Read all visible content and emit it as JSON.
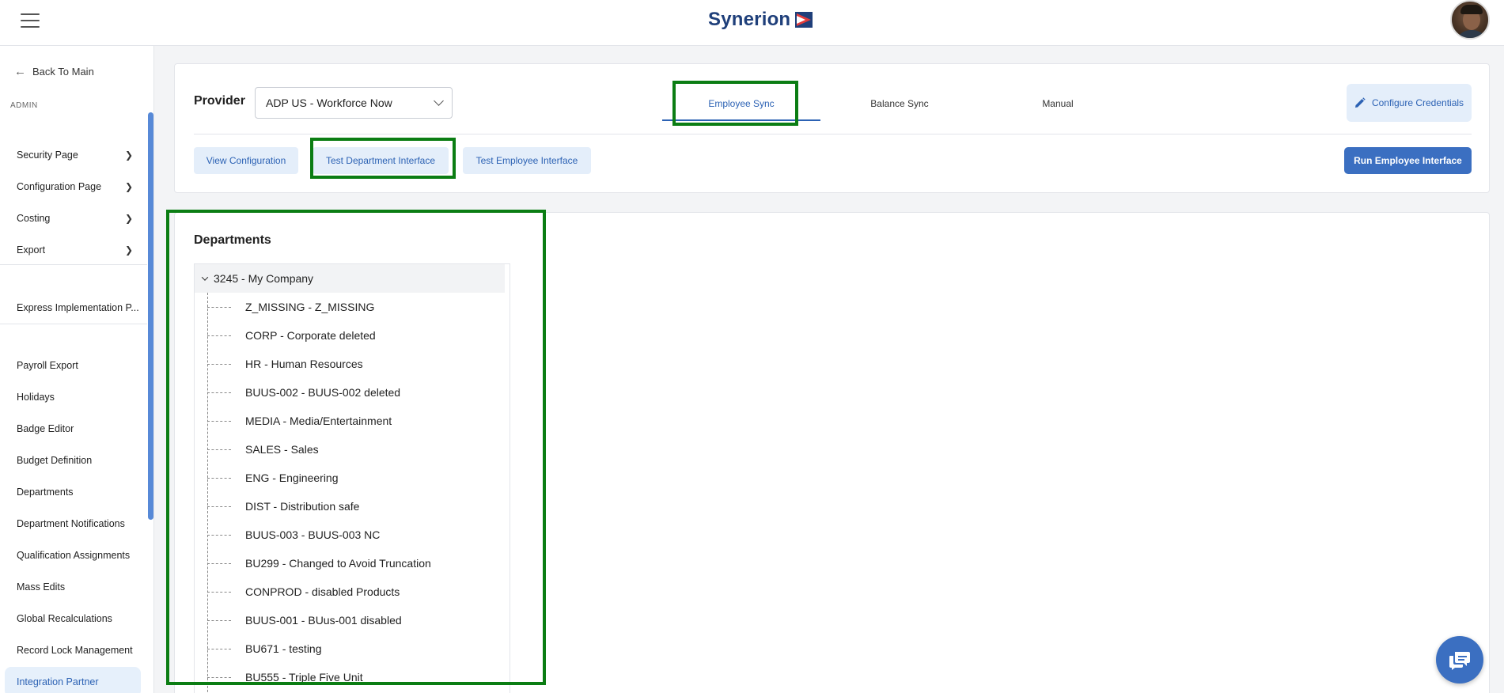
{
  "header": {
    "logo_text": "Synerion",
    "brand_color": "#1f3f7a",
    "accent_color": "#e23b3b"
  },
  "sidebar": {
    "back_label": "Back To Main",
    "section_label": "ADMIN",
    "group_items": [
      {
        "label": "Security Page"
      },
      {
        "label": "Configuration Page"
      },
      {
        "label": "Costing"
      },
      {
        "label": "Export"
      }
    ],
    "express_item": "Express Implementation P...",
    "items": [
      {
        "label": "Payroll Export"
      },
      {
        "label": "Holidays"
      },
      {
        "label": "Badge Editor"
      },
      {
        "label": "Budget Definition"
      },
      {
        "label": "Departments"
      },
      {
        "label": "Department Notifications"
      },
      {
        "label": "Qualification Assignments"
      },
      {
        "label": "Mass Edits"
      },
      {
        "label": "Global Recalculations"
      },
      {
        "label": "Record Lock Management"
      },
      {
        "label": "Integration Partner"
      }
    ],
    "active_item": "Integration Partner"
  },
  "toolbar": {
    "provider_label": "Provider",
    "provider_value": "ADP US - Workforce Now",
    "tabs": [
      {
        "label": "Employee Sync",
        "active": true
      },
      {
        "label": "Balance Sync",
        "active": false
      },
      {
        "label": "Manual",
        "active": false
      }
    ],
    "configure_label": "Configure Credentials",
    "actions": [
      {
        "label": "View Configuration"
      },
      {
        "label": "Test Department Interface"
      },
      {
        "label": "Test Employee Interface"
      }
    ],
    "run_label": "Run Employee Interface"
  },
  "departments": {
    "title": "Departments",
    "root": "3245 - My Company",
    "children": [
      "Z_MISSING - Z_MISSING",
      "CORP - Corporate deleted",
      "HR - Human Resources",
      "BUUS-002 - BUUS-002 deleted",
      "MEDIA - Media/Entertainment",
      "SALES - Sales",
      "ENG - Engineering",
      "DIST - Distribution safe",
      "BUUS-003 - BUUS-003 NC",
      "BU299 - Changed to Avoid Truncation",
      "CONPROD - disabled Products",
      "BUUS-001 - BUus-001 disabled",
      "BU671 - testing",
      "BU555 - Triple Five Unit"
    ]
  },
  "highlight_color": "#0b7d13",
  "primary_color": "#3b6fc1"
}
